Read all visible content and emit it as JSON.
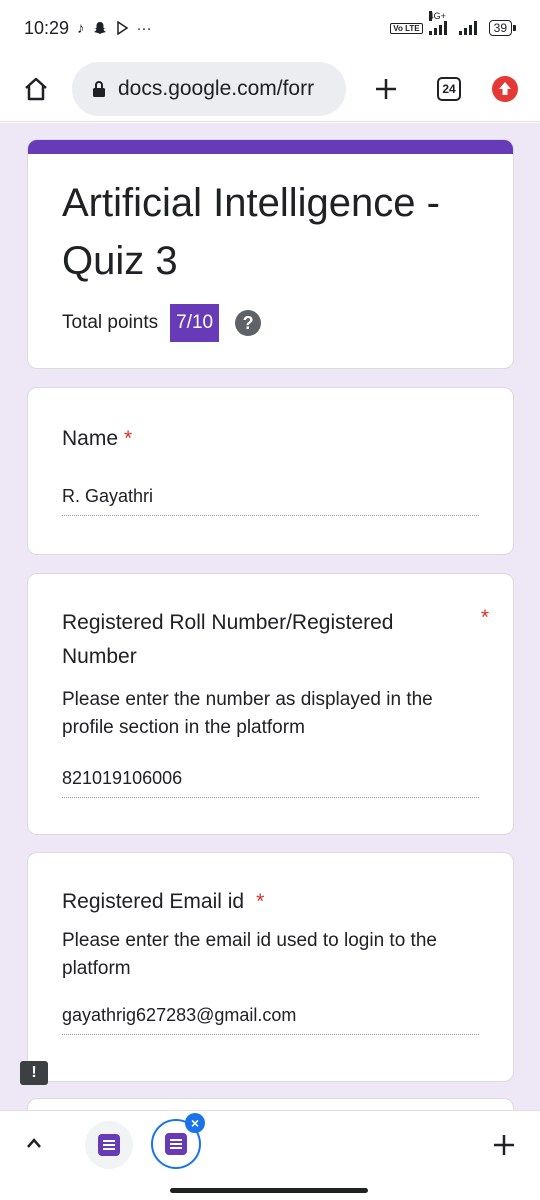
{
  "status_bar": {
    "time": "10:29",
    "network_type": "4G+",
    "volte_label": "Vo LTE",
    "battery_level": "39"
  },
  "browser": {
    "url": "docs.google.com/forr",
    "tab_count": "24"
  },
  "form": {
    "accent_color": "#673ab7",
    "title": "Artificial Intelligence - Quiz 3",
    "points_label": "Total points",
    "points_value": "7/10",
    "help_glyph": "?",
    "questions": [
      {
        "title": "Name",
        "required_mark": "*",
        "description": "",
        "answer": "R. Gayathri"
      },
      {
        "title": "Registered Roll Number/Registered Number",
        "required_mark": "*",
        "description": "Please enter the number as displayed in the profile section in the platform",
        "answer": "821019106006"
      },
      {
        "title": "Registered Email id",
        "required_mark": "*",
        "description": "Please enter the email id used to login to the platform",
        "answer": "gayathrig627283@gmail.com"
      }
    ]
  },
  "icons": {
    "home": "home-icon",
    "lock": "lock-icon",
    "new_tab": "plus-icon",
    "update": "update-arrow-icon",
    "feedback": "feedback-icon",
    "back": "chevron-up-icon",
    "add_tab": "plus-icon"
  }
}
